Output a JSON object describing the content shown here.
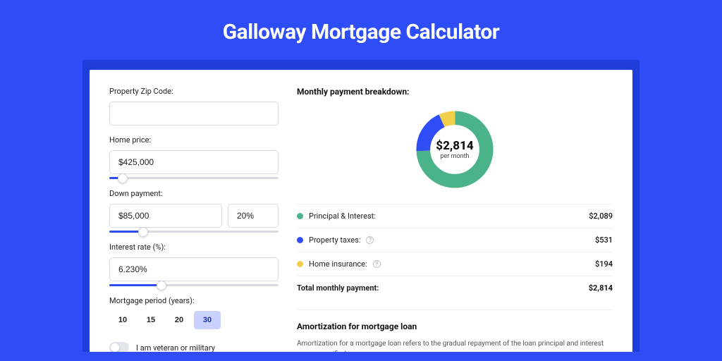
{
  "app_title": "Galloway Mortgage Calculator",
  "colors": {
    "brand": "#2e4df6",
    "green": "#4bb38a",
    "yellow": "#f1cf4d"
  },
  "form": {
    "zip_label": "Property Zip Code:",
    "zip_value": "",
    "home_price_label": "Home price:",
    "home_price_value": "$425,000",
    "home_price_slider_pct": 8,
    "down_label": "Down payment:",
    "down_value": "$85,000",
    "down_pct_value": "20%",
    "down_slider_pct": 20,
    "rate_label": "Interest rate (%):",
    "rate_value": "6.230%",
    "rate_slider_pct": 31,
    "period_label": "Mortgage period (years):",
    "periods": [
      "10",
      "15",
      "20",
      "30"
    ],
    "period_selected_index": 3,
    "veteran_label": "I am veteran or military",
    "veteran_on": false
  },
  "breakdown": {
    "title": "Monthly payment breakdown:",
    "center_amount": "$2,814",
    "center_sub": "per month",
    "items": [
      {
        "label": "Principal & Interest:",
        "value": "$2,089",
        "color": "green",
        "help": false
      },
      {
        "label": "Property taxes:",
        "value": "$531",
        "color": "blue",
        "help": true
      },
      {
        "label": "Home insurance:",
        "value": "$194",
        "color": "yellow",
        "help": true
      }
    ],
    "total_label": "Total monthly payment:",
    "total_value": "$2,814"
  },
  "chart_data": {
    "type": "pie",
    "title": "Monthly payment breakdown",
    "series": [
      {
        "name": "Principal & Interest",
        "value": 2089,
        "color": "#4bb38a"
      },
      {
        "name": "Property taxes",
        "value": 531,
        "color": "#2e4df6"
      },
      {
        "name": "Home insurance",
        "value": 194,
        "color": "#f1cf4d"
      }
    ],
    "total": 2814,
    "center_label": "$2,814 per month"
  },
  "amortization": {
    "title": "Amortization for mortgage loan",
    "text": "Amortization for a mortgage loan refers to the gradual repayment of the loan principal and interest over a specified"
  }
}
